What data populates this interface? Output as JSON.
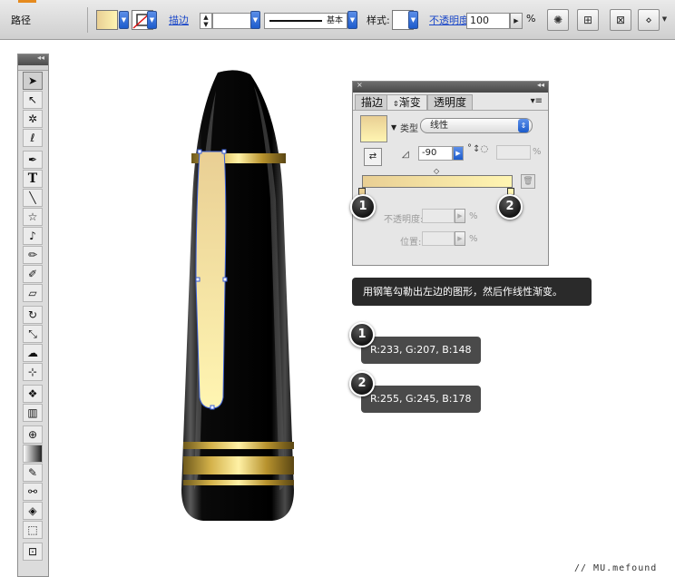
{
  "control_bar": {
    "object_label": "路径",
    "stroke_link": "描边",
    "stroke_style_label": "基本",
    "style_label": "样式:",
    "opacity_link": "不透明度",
    "opacity_value": "100",
    "percent": "%"
  },
  "gradient_panel": {
    "tabs": [
      "描边",
      "渐变",
      "透明度"
    ],
    "type_label": "类型",
    "type_value": "线性",
    "angle_value": "-90",
    "degree_symbol": "°",
    "percent": "%",
    "opacity_label": "不透明度:",
    "position_label": "位置:",
    "stop_color_1": "#e9cf94",
    "stop_color_2": "#fff5b2"
  },
  "annotations": {
    "instruction": "用钢笔勾勒出左边的图形，然后作线性渐变。",
    "stop1_number": "1",
    "stop2_number": "2",
    "stop1_rgb": "R:233, G:207, B:148",
    "stop2_rgb": "R:255, G:245, B:178"
  },
  "credit": "// MU.mefound",
  "tools": [
    "selection-tool",
    "direct-selection-tool",
    "magic-wand-tool",
    "lasso-tool",
    "pen-tool",
    "type-tool",
    "line-tool",
    "star-tool",
    "paintbrush-tool",
    "pencil-tool",
    "blob-brush-tool",
    "eraser-tool",
    "rotate-tool",
    "scale-tool",
    "warp-tool",
    "free-transform-tool",
    "symbol-sprayer-tool",
    "graph-tool",
    "mesh-tool",
    "gradient-tool",
    "eyedropper-tool",
    "blend-tool",
    "live-paint-tool",
    "live-paint-selection-tool",
    "crop-tool"
  ]
}
